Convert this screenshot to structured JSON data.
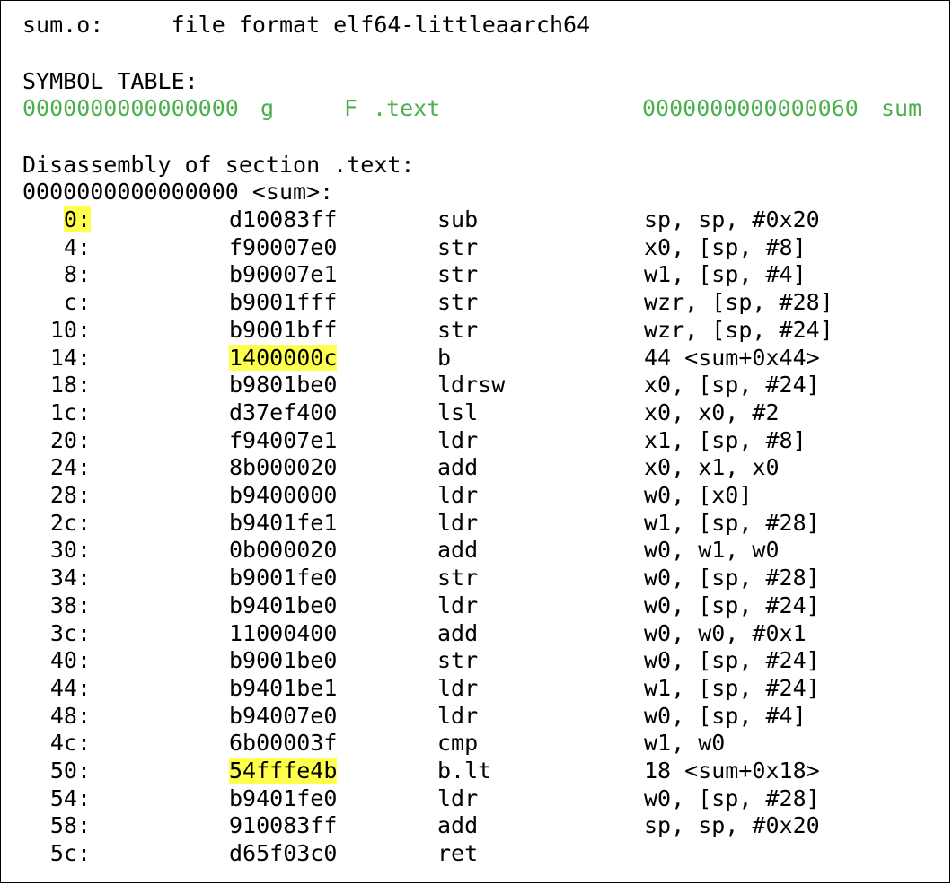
{
  "header": {
    "file_line": "sum.o:     file format elf64-littleaarch64"
  },
  "symbol_table": {
    "title": "SYMBOL TABLE:",
    "entry": {
      "value": "0000000000000000",
      "flag": "g",
      "type": "F",
      "section": ".text",
      "size": "0000000000000060",
      "name": "sum"
    }
  },
  "disassembly": {
    "section_title": "Disassembly of section .text:",
    "function_label": "0000000000000000 <sum>:",
    "instructions": [
      {
        "addr": "0:",
        "hex": "d10083ff",
        "mnemonic": "sub",
        "operands": "sp, sp, #0x20"
      },
      {
        "addr": "4:",
        "hex": "f90007e0",
        "mnemonic": "str",
        "operands": "x0, [sp, #8]"
      },
      {
        "addr": "8:",
        "hex": "b90007e1",
        "mnemonic": "str",
        "operands": "w1, [sp, #4]"
      },
      {
        "addr": "c:",
        "hex": "b9001fff",
        "mnemonic": "str",
        "operands": "wzr, [sp, #28]"
      },
      {
        "addr": "10:",
        "hex": "b9001bff",
        "mnemonic": "str",
        "operands": "wzr, [sp, #24]"
      },
      {
        "addr": "14:",
        "hex": "1400000c",
        "mnemonic": "b",
        "operands": "44 <sum+0x44>"
      },
      {
        "addr": "18:",
        "hex": "b9801be0",
        "mnemonic": "ldrsw",
        "operands": "x0, [sp, #24]"
      },
      {
        "addr": "1c:",
        "hex": "d37ef400",
        "mnemonic": "lsl",
        "operands": "x0, x0, #2"
      },
      {
        "addr": "20:",
        "hex": "f94007e1",
        "mnemonic": "ldr",
        "operands": "x1, [sp, #8]"
      },
      {
        "addr": "24:",
        "hex": "8b000020",
        "mnemonic": "add",
        "operands": "x0, x1, x0"
      },
      {
        "addr": "28:",
        "hex": "b9400000",
        "mnemonic": "ldr",
        "operands": "w0, [x0]"
      },
      {
        "addr": "2c:",
        "hex": "b9401fe1",
        "mnemonic": "ldr",
        "operands": "w1, [sp, #28]"
      },
      {
        "addr": "30:",
        "hex": "0b000020",
        "mnemonic": "add",
        "operands": "w0, w1, w0"
      },
      {
        "addr": "34:",
        "hex": "b9001fe0",
        "mnemonic": "str",
        "operands": "w0, [sp, #28]"
      },
      {
        "addr": "38:",
        "hex": "b9401be0",
        "mnemonic": "ldr",
        "operands": "w0, [sp, #24]"
      },
      {
        "addr": "3c:",
        "hex": "11000400",
        "mnemonic": "add",
        "operands": "w0, w0, #0x1"
      },
      {
        "addr": "40:",
        "hex": "b9001be0",
        "mnemonic": "str",
        "operands": "w0, [sp, #24]"
      },
      {
        "addr": "44:",
        "hex": "b9401be1",
        "mnemonic": "ldr",
        "operands": "w1, [sp, #24]"
      },
      {
        "addr": "48:",
        "hex": "b94007e0",
        "mnemonic": "ldr",
        "operands": "w0, [sp, #4]"
      },
      {
        "addr": "4c:",
        "hex": "6b00003f",
        "mnemonic": "cmp",
        "operands": "w1, w0"
      },
      {
        "addr": "50:",
        "hex": "54fffe4b",
        "mnemonic": "b.lt",
        "operands": "18 <sum+0x18>"
      },
      {
        "addr": "54:",
        "hex": "b9401fe0",
        "mnemonic": "ldr",
        "operands": "w0, [sp, #28]"
      },
      {
        "addr": "58:",
        "hex": "910083ff",
        "mnemonic": "add",
        "operands": "sp, sp, #0x20"
      },
      {
        "addr": "5c:",
        "hex": "d65f03c0",
        "mnemonic": "ret",
        "operands": ""
      }
    ],
    "highlighted_addrs": [
      "0:"
    ],
    "highlighted_hex": [
      "1400000c",
      "54fffe4b"
    ]
  },
  "colors": {
    "symbol_entry": "#4caf50",
    "highlight": "#ffff4d"
  }
}
